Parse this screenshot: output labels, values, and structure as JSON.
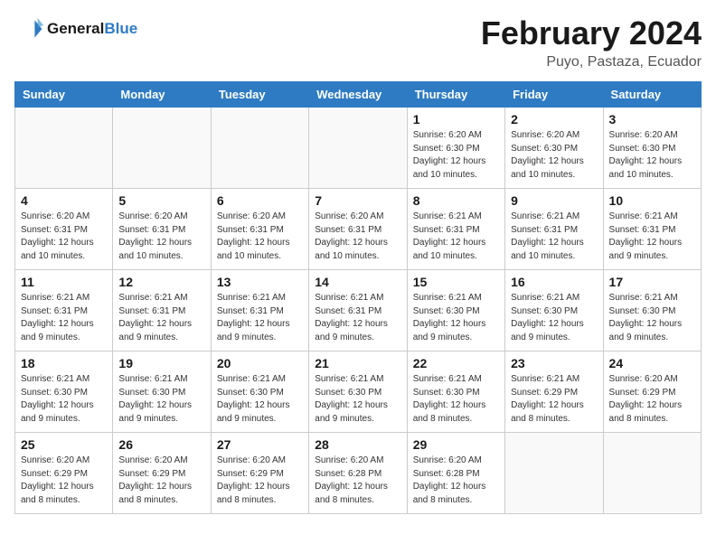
{
  "header": {
    "logo_general": "General",
    "logo_blue": "Blue",
    "month_year": "February 2024",
    "location": "Puyo, Pastaza, Ecuador"
  },
  "days_of_week": [
    "Sunday",
    "Monday",
    "Tuesday",
    "Wednesday",
    "Thursday",
    "Friday",
    "Saturday"
  ],
  "weeks": [
    [
      {
        "day": "",
        "info": ""
      },
      {
        "day": "",
        "info": ""
      },
      {
        "day": "",
        "info": ""
      },
      {
        "day": "",
        "info": ""
      },
      {
        "day": "1",
        "info": "Sunrise: 6:20 AM\nSunset: 6:30 PM\nDaylight: 12 hours\nand 10 minutes."
      },
      {
        "day": "2",
        "info": "Sunrise: 6:20 AM\nSunset: 6:30 PM\nDaylight: 12 hours\nand 10 minutes."
      },
      {
        "day": "3",
        "info": "Sunrise: 6:20 AM\nSunset: 6:30 PM\nDaylight: 12 hours\nand 10 minutes."
      }
    ],
    [
      {
        "day": "4",
        "info": "Sunrise: 6:20 AM\nSunset: 6:31 PM\nDaylight: 12 hours\nand 10 minutes."
      },
      {
        "day": "5",
        "info": "Sunrise: 6:20 AM\nSunset: 6:31 PM\nDaylight: 12 hours\nand 10 minutes."
      },
      {
        "day": "6",
        "info": "Sunrise: 6:20 AM\nSunset: 6:31 PM\nDaylight: 12 hours\nand 10 minutes."
      },
      {
        "day": "7",
        "info": "Sunrise: 6:20 AM\nSunset: 6:31 PM\nDaylight: 12 hours\nand 10 minutes."
      },
      {
        "day": "8",
        "info": "Sunrise: 6:21 AM\nSunset: 6:31 PM\nDaylight: 12 hours\nand 10 minutes."
      },
      {
        "day": "9",
        "info": "Sunrise: 6:21 AM\nSunset: 6:31 PM\nDaylight: 12 hours\nand 10 minutes."
      },
      {
        "day": "10",
        "info": "Sunrise: 6:21 AM\nSunset: 6:31 PM\nDaylight: 12 hours\nand 9 minutes."
      }
    ],
    [
      {
        "day": "11",
        "info": "Sunrise: 6:21 AM\nSunset: 6:31 PM\nDaylight: 12 hours\nand 9 minutes."
      },
      {
        "day": "12",
        "info": "Sunrise: 6:21 AM\nSunset: 6:31 PM\nDaylight: 12 hours\nand 9 minutes."
      },
      {
        "day": "13",
        "info": "Sunrise: 6:21 AM\nSunset: 6:31 PM\nDaylight: 12 hours\nand 9 minutes."
      },
      {
        "day": "14",
        "info": "Sunrise: 6:21 AM\nSunset: 6:31 PM\nDaylight: 12 hours\nand 9 minutes."
      },
      {
        "day": "15",
        "info": "Sunrise: 6:21 AM\nSunset: 6:30 PM\nDaylight: 12 hours\nand 9 minutes."
      },
      {
        "day": "16",
        "info": "Sunrise: 6:21 AM\nSunset: 6:30 PM\nDaylight: 12 hours\nand 9 minutes."
      },
      {
        "day": "17",
        "info": "Sunrise: 6:21 AM\nSunset: 6:30 PM\nDaylight: 12 hours\nand 9 minutes."
      }
    ],
    [
      {
        "day": "18",
        "info": "Sunrise: 6:21 AM\nSunset: 6:30 PM\nDaylight: 12 hours\nand 9 minutes."
      },
      {
        "day": "19",
        "info": "Sunrise: 6:21 AM\nSunset: 6:30 PM\nDaylight: 12 hours\nand 9 minutes."
      },
      {
        "day": "20",
        "info": "Sunrise: 6:21 AM\nSunset: 6:30 PM\nDaylight: 12 hours\nand 9 minutes."
      },
      {
        "day": "21",
        "info": "Sunrise: 6:21 AM\nSunset: 6:30 PM\nDaylight: 12 hours\nand 9 minutes."
      },
      {
        "day": "22",
        "info": "Sunrise: 6:21 AM\nSunset: 6:30 PM\nDaylight: 12 hours\nand 8 minutes."
      },
      {
        "day": "23",
        "info": "Sunrise: 6:21 AM\nSunset: 6:29 PM\nDaylight: 12 hours\nand 8 minutes."
      },
      {
        "day": "24",
        "info": "Sunrise: 6:20 AM\nSunset: 6:29 PM\nDaylight: 12 hours\nand 8 minutes."
      }
    ],
    [
      {
        "day": "25",
        "info": "Sunrise: 6:20 AM\nSunset: 6:29 PM\nDaylight: 12 hours\nand 8 minutes."
      },
      {
        "day": "26",
        "info": "Sunrise: 6:20 AM\nSunset: 6:29 PM\nDaylight: 12 hours\nand 8 minutes."
      },
      {
        "day": "27",
        "info": "Sunrise: 6:20 AM\nSunset: 6:29 PM\nDaylight: 12 hours\nand 8 minutes."
      },
      {
        "day": "28",
        "info": "Sunrise: 6:20 AM\nSunset: 6:28 PM\nDaylight: 12 hours\nand 8 minutes."
      },
      {
        "day": "29",
        "info": "Sunrise: 6:20 AM\nSunset: 6:28 PM\nDaylight: 12 hours\nand 8 minutes."
      },
      {
        "day": "",
        "info": ""
      },
      {
        "day": "",
        "info": ""
      }
    ]
  ]
}
